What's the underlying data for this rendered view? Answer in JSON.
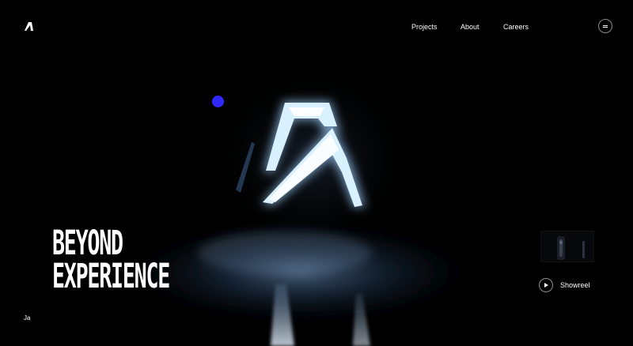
{
  "header": {
    "logo_icon": "brand-logo-icon",
    "nav": {
      "items": [
        {
          "label": "Projects"
        },
        {
          "label": "About"
        },
        {
          "label": "Careers"
        }
      ]
    },
    "menu_icon": "hamburger-menu-icon"
  },
  "hero": {
    "title_line_1": "BEYOND",
    "title_line_2": "EXPERIENCE",
    "corner_text": "Ja"
  },
  "showreel": {
    "label": "Showreel",
    "play_icon": "play-icon"
  },
  "colors": {
    "background": "#000000",
    "text": "#ffffff",
    "cursor_dot": "#2f29ff",
    "glow": "#bfe6ff"
  }
}
